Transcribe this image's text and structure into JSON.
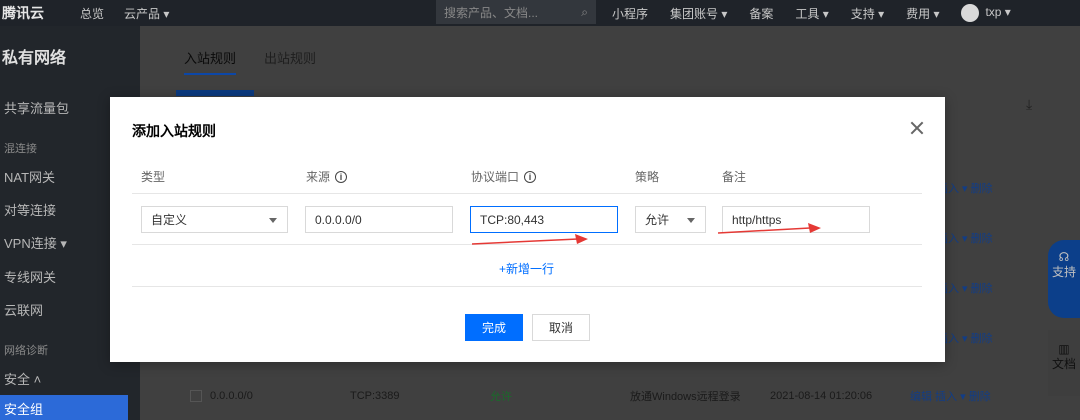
{
  "topnav": {
    "logo": "腾讯云",
    "links": [
      "总览",
      "云产品 ▾"
    ],
    "search_placeholder": "搜索产品、文档...",
    "right_items": [
      "小程序",
      "集团账号 ▾",
      "备案",
      "工具 ▾",
      "支持 ▾",
      "费用 ▾"
    ],
    "user": "txp ▾"
  },
  "sidebar": {
    "title": "私有网络",
    "items": [
      {
        "label": "共享流量包",
        "kind": "item"
      },
      {
        "label": "混连接",
        "kind": "group"
      },
      {
        "label": "NAT网关",
        "kind": "item"
      },
      {
        "label": "对等连接",
        "kind": "item"
      },
      {
        "label": "VPN连接 ▾",
        "kind": "item"
      },
      {
        "label": "专线网关",
        "kind": "item"
      },
      {
        "label": "云联网",
        "kind": "item"
      },
      {
        "label": "网络诊断",
        "kind": "group"
      },
      {
        "label": "安全 ˄",
        "kind": "item"
      }
    ],
    "active_item": "安全组"
  },
  "content": {
    "tabs": [
      "入站规则",
      "出站规则"
    ],
    "active_tab": 0,
    "row_actions": "插入 ▾ 删除",
    "bg_row": {
      "source": "0.0.0.0/0",
      "port": "TCP:3389",
      "policy": "允许",
      "note": "放通Windows远程登录",
      "time": "2021-08-14 01:20:06",
      "actions": "编辑  插入 ▾  删除"
    }
  },
  "floats": {
    "support": "支持",
    "docs": "文档"
  },
  "modal": {
    "title": "添加入站规则",
    "columns": {
      "type": "类型",
      "source": "来源",
      "port": "协议端口",
      "policy": "策略",
      "note": "备注"
    },
    "row": {
      "type": "自定义",
      "source": "0.0.0.0/0",
      "port": "TCP:80,443",
      "policy": "允许",
      "note": "http/https"
    },
    "add_row": "+新增一行",
    "confirm": "完成",
    "cancel": "取消"
  },
  "colors": {
    "primary": "#006eff",
    "annotation_arrow": "#e53935"
  }
}
